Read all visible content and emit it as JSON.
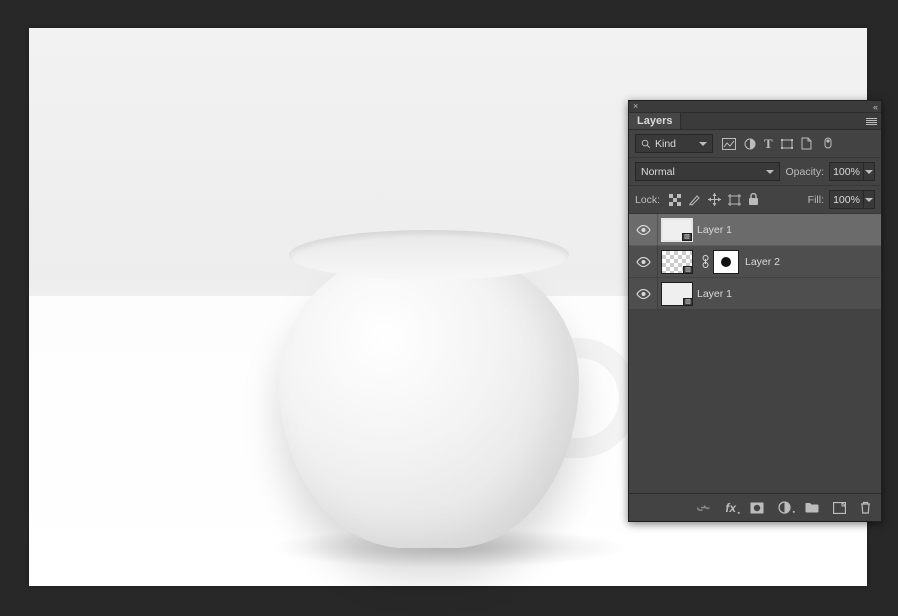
{
  "panel": {
    "tab_label": "Layers",
    "filter": {
      "kind_label": "Kind"
    },
    "blend_mode": "Normal",
    "opacity_label": "Opacity:",
    "opacity_value": "100%",
    "lock_label": "Lock:",
    "fill_label": "Fill:",
    "fill_value": "100%",
    "layers": [
      {
        "name": "Layer 1",
        "selected": true,
        "has_mask": false,
        "checker": false
      },
      {
        "name": "Layer 2",
        "selected": false,
        "has_mask": true,
        "checker": true
      },
      {
        "name": "Layer 1",
        "selected": false,
        "has_mask": false,
        "checker": false
      }
    ]
  }
}
